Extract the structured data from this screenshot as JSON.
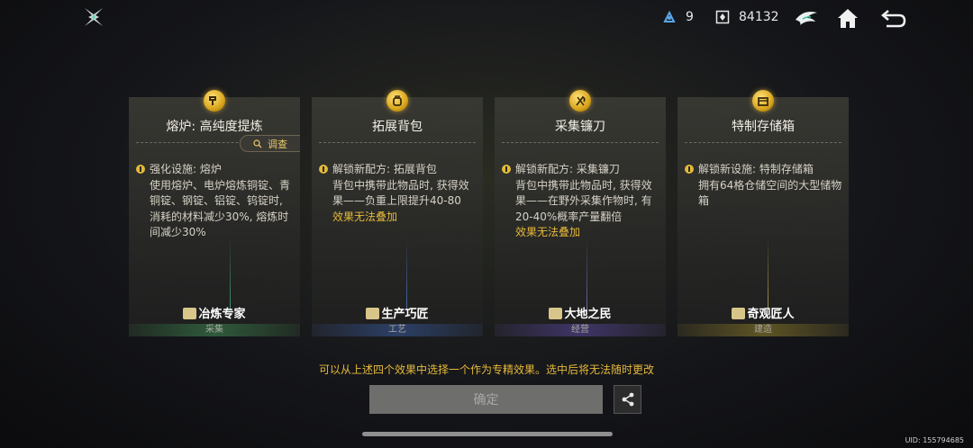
{
  "topbar": {
    "logo_icon": "cross-star-logo-icon",
    "energy_icon": "energy-icon",
    "energy_value": "9",
    "currency_icon": "currency-icon",
    "currency_value": "84132",
    "buttons": [
      "wing-emblem-icon",
      "home-icon",
      "back-arrow-icon"
    ]
  },
  "cards": [
    {
      "title": "熔炉: 高纯度提炼",
      "has_inspect": true,
      "inspect_label": "调查",
      "bullet_text": "强化设施: 熔炉",
      "description": "使用熔炉、电炉熔炼铜锭、青铜锭、钢锭、铝锭、钨锭时, 消耗的材料减少30%, 熔炼时间减少30%",
      "warning": "",
      "skill_name": "冶炼专家",
      "category": "采集",
      "accent": "#2f5a3a"
    },
    {
      "title": "拓展背包",
      "has_inspect": false,
      "inspect_label": "",
      "bullet_text": "解锁新配方: 拓展背包",
      "description": "背包中携带此物品时, 获得效果——负重上限提升40-80",
      "warning": "效果无法叠加",
      "skill_name": "生产巧匠",
      "category": "工艺",
      "accent": "#2c3f66"
    },
    {
      "title": "采集镰刀",
      "has_inspect": false,
      "inspect_label": "",
      "bullet_text": "解锁新配方: 采集镰刀",
      "description": "背包中携带此物品时, 获得效果——在野外采集作物时, 有20-40%概率产量翻倍",
      "warning": "效果无法叠加",
      "skill_name": "大地之民",
      "category": "经营",
      "accent": "#3f3566"
    },
    {
      "title": "特制存储箱",
      "has_inspect": false,
      "inspect_label": "",
      "bullet_text": "解锁新设施: 特制存储箱",
      "description": "拥有64格仓储空间的大型储物箱",
      "warning": "",
      "skill_name": "奇观匠人",
      "category": "建造",
      "accent": "#5e5424"
    }
  ],
  "note": "可以从上述四个效果中选择一个作为专精效果。选中后将无法随时更改",
  "confirm_label": "确定",
  "share_icon": "share-icon",
  "uid": "UID: 155794685"
}
